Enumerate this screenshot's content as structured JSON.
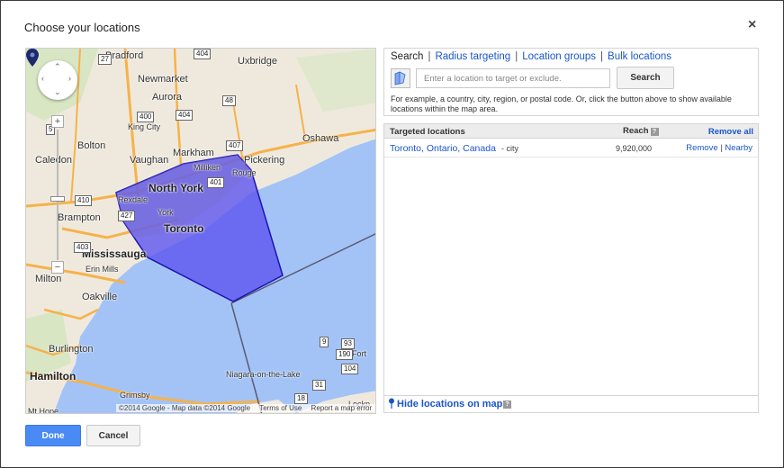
{
  "dialog": {
    "title": "Choose your locations",
    "close_glyph": "×"
  },
  "map": {
    "labels": {
      "bradford": "Bradford",
      "uxbridge": "Uxbridge",
      "newmarket": "Newmarket",
      "aurora": "Aurora",
      "king_city": "King City",
      "bolton": "Bolton",
      "markham": "Markham",
      "oshawa": "Oshawa",
      "caledon": "Caledon",
      "vaughan": "Vaughan",
      "pickering": "Pickering",
      "milliken": "Milliken",
      "rouge": "Rouge",
      "north_york": "North York",
      "rexdale": "Rexdale",
      "york": "York",
      "toronto": "Toronto",
      "brampton": "Brampton",
      "mississauga": "Mississauga",
      "erin_mills": "Erin Mills",
      "milton": "Milton",
      "oakville": "Oakville",
      "burlington": "Burlington",
      "hamilton": "Hamilton",
      "niagara": "Niagara-on-the-Lake",
      "grimsby": "Grimsby",
      "mt_hope": "Mt Hope",
      "fort": "Fort",
      "lockp": "Lockp"
    },
    "shields": {
      "s27": "27",
      "s404a": "404",
      "s48": "48",
      "s400": "400",
      "s404b": "404",
      "s407": "407",
      "s401": "401",
      "s410": "410",
      "s427": "427",
      "s403": "403",
      "s190": "190",
      "s93": "93",
      "s104": "104",
      "s31": "31",
      "s18": "18",
      "s9": "9",
      "s5": "5"
    },
    "pan_arrows": {
      "up": "⌃",
      "down": "⌄",
      "left": "‹",
      "right": "›"
    },
    "zoom_in": "+",
    "zoom_out": "−",
    "footer": {
      "copyright": "©2014 Google - Map data ©2014 Google",
      "terms": "Terms of Use",
      "report": "Report a map error"
    },
    "colors": {
      "land": "#efe9dd",
      "water": "#a3c3f7",
      "region_fill": "#5a52f0",
      "region_stroke": "#1b13b0",
      "highway": "#f6b24a"
    }
  },
  "search": {
    "tabs": [
      {
        "label": "Search",
        "active": true
      },
      {
        "label": "Radius targeting",
        "active": false
      },
      {
        "label": "Location groups",
        "active": false
      },
      {
        "label": "Bulk locations",
        "active": false
      }
    ],
    "tab_separator": "|",
    "placeholder": "Enter a location to target or exclude.",
    "button_label": "Search",
    "hint": "For example, a country, city, region, or postal code. Or, click the button above to show available locations within the map area."
  },
  "targeted": {
    "header": {
      "location": "Targeted locations",
      "reach": "Reach",
      "help_glyph": "?",
      "remove_all": "Remove all"
    },
    "rows": [
      {
        "location": "Toronto, Ontario, Canada",
        "type": "- city",
        "reach": "9,920,000",
        "remove": "Remove",
        "separator": "|",
        "nearby": "Nearby"
      }
    ],
    "footer_label": "Hide locations on map",
    "footer_help": "?"
  },
  "actions": {
    "done": "Done",
    "cancel": "Cancel"
  }
}
